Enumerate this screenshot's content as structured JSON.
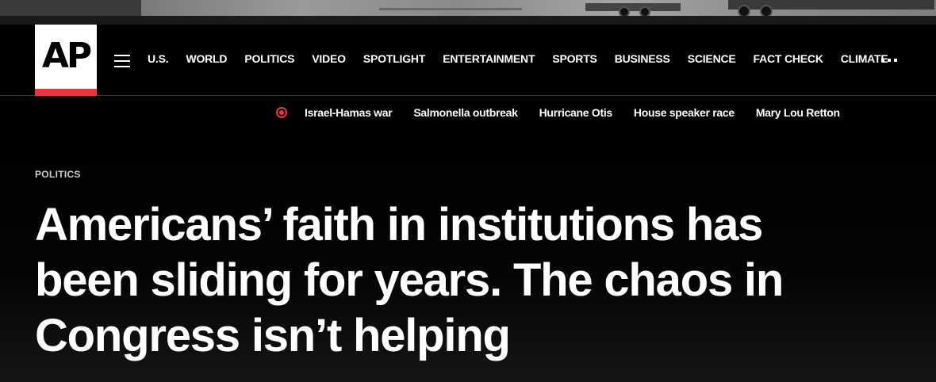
{
  "logo": {
    "text": "AP"
  },
  "nav": {
    "items": [
      "U.S.",
      "WORLD",
      "POLITICS",
      "VIDEO",
      "SPOTLIGHT",
      "ENTERTAINMENT",
      "SPORTS",
      "BUSINESS",
      "SCIENCE",
      "FACT CHECK",
      "CLIMATE"
    ]
  },
  "trending": {
    "items": [
      "Israel-Hamas war",
      "Salmonella outbreak",
      "Hurricane Otis",
      "House speaker race",
      "Mary Lou Retton"
    ]
  },
  "article": {
    "kicker": "POLITICS",
    "headline": "Americans’ faith in institutions has been sliding for years. The chaos in Congress isn’t helping"
  },
  "colors": {
    "brand_red": "#ef3340",
    "background": "#000000"
  },
  "icons": [
    "hamburger-menu-icon",
    "more-dots-icon",
    "live-indicator-icon"
  ]
}
